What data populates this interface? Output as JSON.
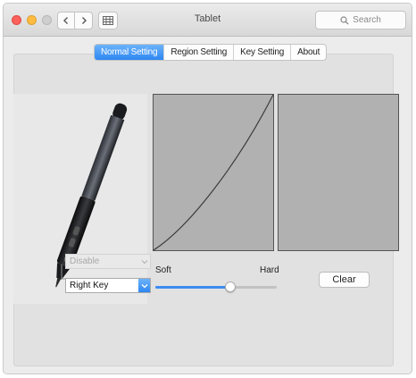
{
  "window": {
    "title": "Tablet"
  },
  "search": {
    "placeholder": "Search"
  },
  "tabs": [
    {
      "label": "Normal Setting",
      "active": true
    },
    {
      "label": "Region Setting",
      "active": false
    },
    {
      "label": "Key Setting",
      "active": false
    },
    {
      "label": "About",
      "active": false
    }
  ],
  "pen_buttons": {
    "upper_key": {
      "value": "Disable",
      "enabled": false
    },
    "lower_key": {
      "value": "Right Key",
      "enabled": true
    }
  },
  "pressure": {
    "soft_label": "Soft",
    "hard_label": "Hard",
    "slider_value_fraction": 0.62
  },
  "clear_button": {
    "label": "Clear"
  },
  "icons": {
    "back": "chevron-left-icon",
    "forward": "chevron-right-icon",
    "grid": "grid-icon",
    "search": "search-icon",
    "dropdown": "chevron-down-icon"
  },
  "colors": {
    "accent": "#2e86f2",
    "graph_bg": "#b1b1b1",
    "close": "#fc605b",
    "minimize": "#fdbc40"
  }
}
